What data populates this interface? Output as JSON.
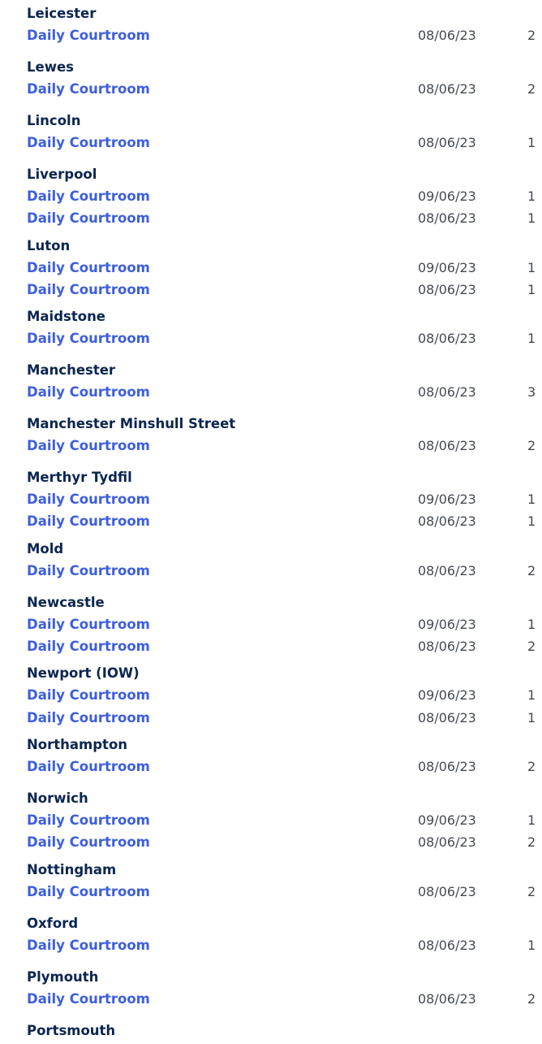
{
  "courts": [
    {
      "name": "Leicester",
      "rooms": [
        {
          "label": "Daily Courtroom",
          "date": "08/06/23",
          "count": "2"
        }
      ]
    },
    {
      "name": "Lewes",
      "rooms": [
        {
          "label": "Daily Courtroom",
          "date": "08/06/23",
          "count": "2"
        }
      ]
    },
    {
      "name": "Lincoln",
      "rooms": [
        {
          "label": "Daily Courtroom",
          "date": "08/06/23",
          "count": "1"
        }
      ]
    },
    {
      "name": "Liverpool",
      "rooms": [
        {
          "label": "Daily Courtroom",
          "date": "09/06/23",
          "count": "1"
        },
        {
          "label": "Daily Courtroom",
          "date": "08/06/23",
          "count": "1"
        }
      ]
    },
    {
      "name": "Luton",
      "rooms": [
        {
          "label": "Daily Courtroom",
          "date": "09/06/23",
          "count": "1"
        },
        {
          "label": "Daily Courtroom",
          "date": "08/06/23",
          "count": "1"
        }
      ]
    },
    {
      "name": "Maidstone",
      "rooms": [
        {
          "label": "Daily Courtroom",
          "date": "08/06/23",
          "count": "1"
        }
      ]
    },
    {
      "name": "Manchester",
      "rooms": [
        {
          "label": "Daily Courtroom",
          "date": "08/06/23",
          "count": "3"
        }
      ]
    },
    {
      "name": "Manchester Minshull Street",
      "rooms": [
        {
          "label": "Daily Courtroom",
          "date": "08/06/23",
          "count": "2"
        }
      ]
    },
    {
      "name": "Merthyr Tydfil",
      "rooms": [
        {
          "label": "Daily Courtroom",
          "date": "09/06/23",
          "count": "1"
        },
        {
          "label": "Daily Courtroom",
          "date": "08/06/23",
          "count": "1"
        }
      ]
    },
    {
      "name": "Mold",
      "rooms": [
        {
          "label": "Daily Courtroom",
          "date": "08/06/23",
          "count": "2"
        }
      ]
    },
    {
      "name": "Newcastle",
      "rooms": [
        {
          "label": "Daily Courtroom",
          "date": "09/06/23",
          "count": "1"
        },
        {
          "label": "Daily Courtroom",
          "date": "08/06/23",
          "count": "2"
        }
      ]
    },
    {
      "name": "Newport (IOW)",
      "rooms": [
        {
          "label": "Daily Courtroom",
          "date": "09/06/23",
          "count": "1"
        },
        {
          "label": "Daily Courtroom",
          "date": "08/06/23",
          "count": "1"
        }
      ]
    },
    {
      "name": "Northampton",
      "rooms": [
        {
          "label": "Daily Courtroom",
          "date": "08/06/23",
          "count": "2"
        }
      ]
    },
    {
      "name": "Norwich",
      "rooms": [
        {
          "label": "Daily Courtroom",
          "date": "09/06/23",
          "count": "1"
        },
        {
          "label": "Daily Courtroom",
          "date": "08/06/23",
          "count": "2"
        }
      ]
    },
    {
      "name": "Nottingham",
      "rooms": [
        {
          "label": "Daily Courtroom",
          "date": "08/06/23",
          "count": "2"
        }
      ]
    },
    {
      "name": "Oxford",
      "rooms": [
        {
          "label": "Daily Courtroom",
          "date": "08/06/23",
          "count": "1"
        }
      ]
    },
    {
      "name": "Plymouth",
      "rooms": [
        {
          "label": "Daily Courtroom",
          "date": "08/06/23",
          "count": "2"
        }
      ]
    },
    {
      "name": "Portsmouth",
      "rooms": []
    }
  ]
}
